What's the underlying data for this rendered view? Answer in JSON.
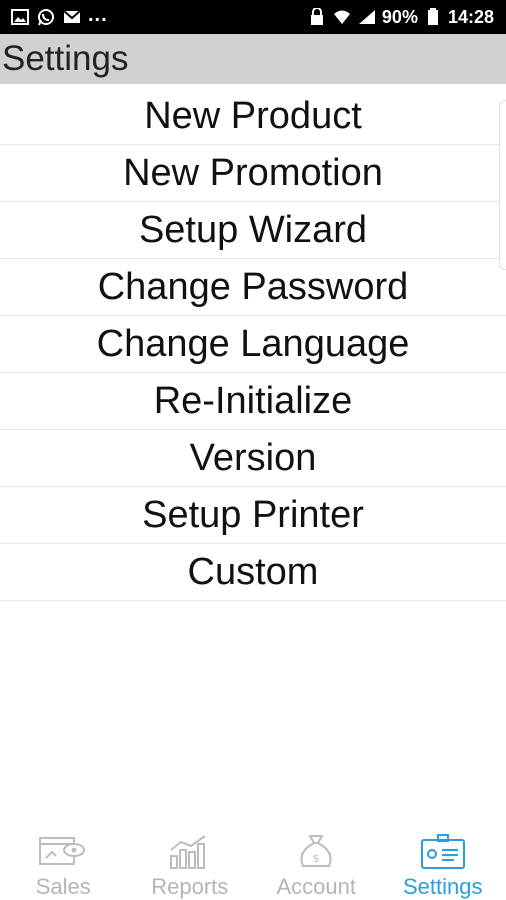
{
  "statusbar": {
    "left_icons": [
      "gallery-icon",
      "whatsapp-icon",
      "mail-icon"
    ],
    "overflow": "...",
    "battery_percent": "90%",
    "time": "14:28"
  },
  "header": {
    "title": "Settings"
  },
  "menu": {
    "items": [
      "New Product",
      "New Promotion",
      "Setup Wizard",
      "Change Password",
      "Change Language",
      "Re-Initialize",
      "Version",
      "Setup Printer",
      "Custom"
    ]
  },
  "bottom_nav": {
    "items": [
      {
        "label": "Sales",
        "icon": "sales-icon",
        "active": false
      },
      {
        "label": "Reports",
        "icon": "reports-icon",
        "active": false
      },
      {
        "label": "Account",
        "icon": "money-bag-icon",
        "active": false
      },
      {
        "label": "Settings",
        "icon": "settings-card-icon",
        "active": true
      }
    ]
  },
  "colors": {
    "active": "#2a9ee0",
    "inactive": "#b5b5b5",
    "titlebar": "#d1d1d1"
  }
}
